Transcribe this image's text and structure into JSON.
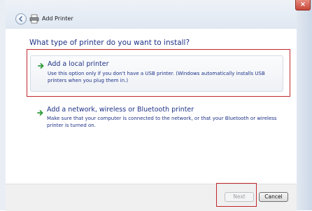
{
  "window": {
    "title": "Add Printer",
    "close_symbol": "×"
  },
  "page": {
    "heading": "What type of printer do you want to install?"
  },
  "options": [
    {
      "title": "Add a local printer",
      "description": "Use this option only if you don't have a USB printer. (Windows automatically installs USB printers when you plug them in.)",
      "icon": "green-arrow-icon"
    },
    {
      "title": "Add a network, wireless or Bluetooth printer",
      "description": "Make sure that your computer is connected to the network, or that your Bluetooth or wireless printer is turned on.",
      "icon": "green-arrow-icon"
    }
  ],
  "buttons": {
    "next_label": "Next",
    "cancel_label": "Cancel"
  },
  "colors": {
    "link_blue": "#1e3287",
    "highlight_red": "#c1272d",
    "arrow_green": "#2e9b3a"
  }
}
